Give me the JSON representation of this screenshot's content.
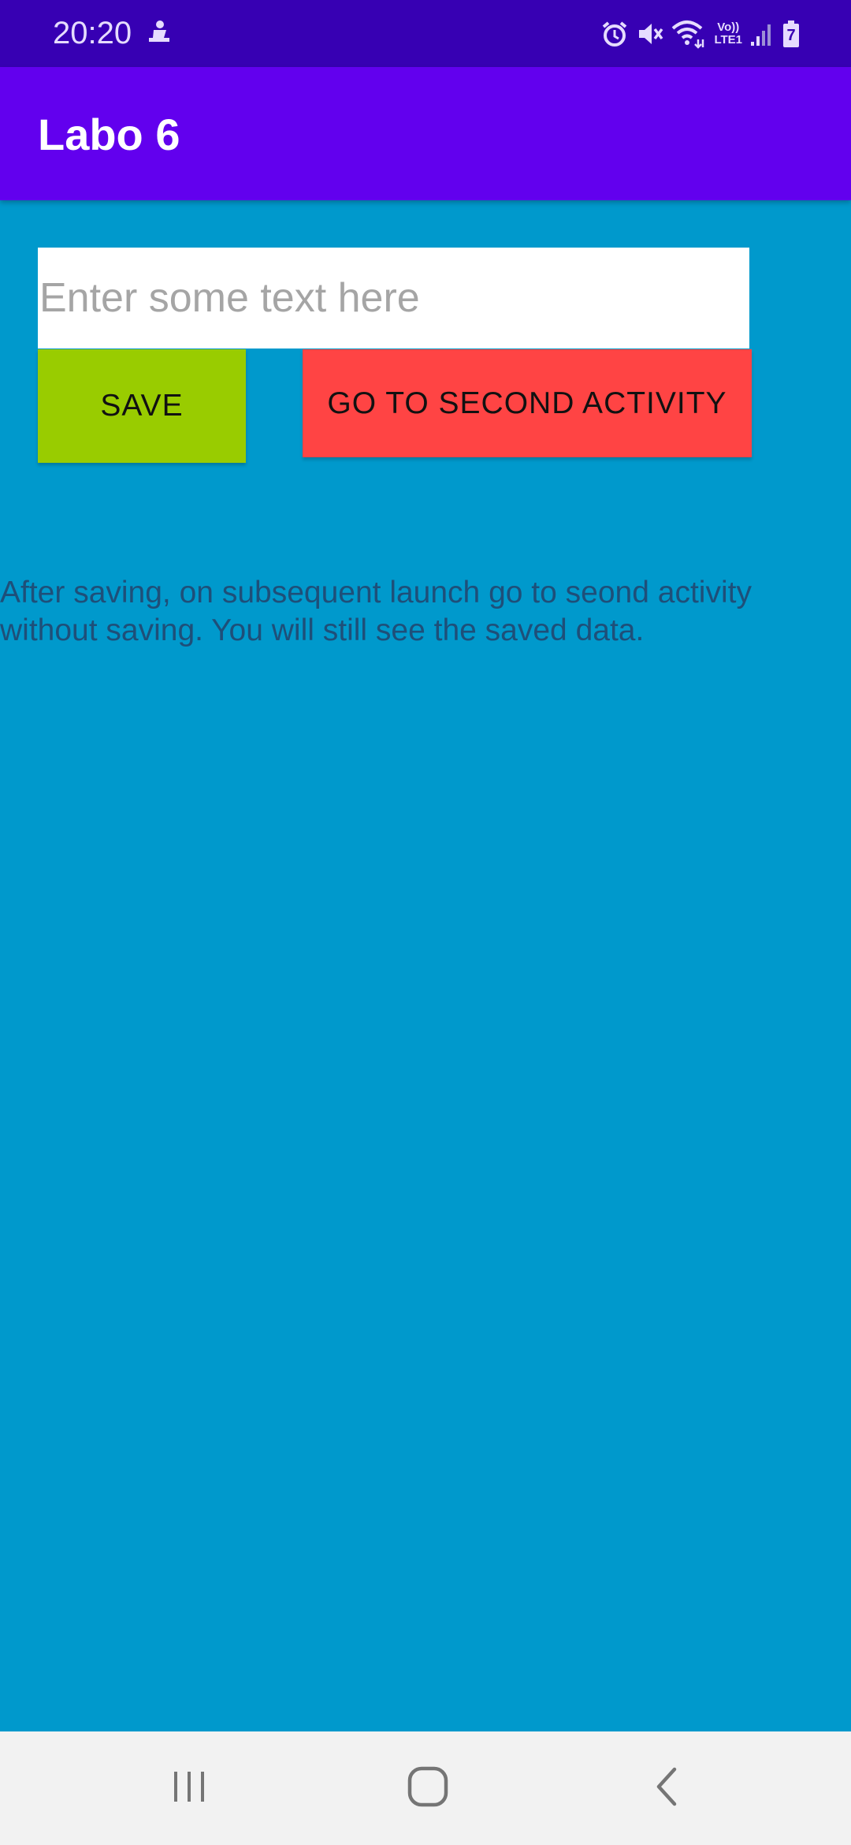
{
  "status_bar": {
    "time": "20:20",
    "volte_top": "Vo))",
    "volte_bottom": "LTE1",
    "battery_level": "7"
  },
  "app_bar": {
    "title": "Labo 6"
  },
  "input": {
    "value": "",
    "placeholder": "Enter some text here"
  },
  "buttons": {
    "save_label": "SAVE",
    "second_activity_label": "GO TO SECOND ACTIVITY"
  },
  "info": {
    "text": "After saving, on subsequent launch go to seond activity without saving. You will still see the saved data."
  },
  "nav_bar": {
    "icons": [
      "recent-apps-icon",
      "home-icon",
      "back-icon"
    ]
  },
  "colors": {
    "status_bar": "#3700b3",
    "app_bar": "#6200ee",
    "background": "#0099cc",
    "save_button": "#99cc00",
    "second_activity_button": "#ff4444",
    "info_text": "#1e4f79"
  }
}
